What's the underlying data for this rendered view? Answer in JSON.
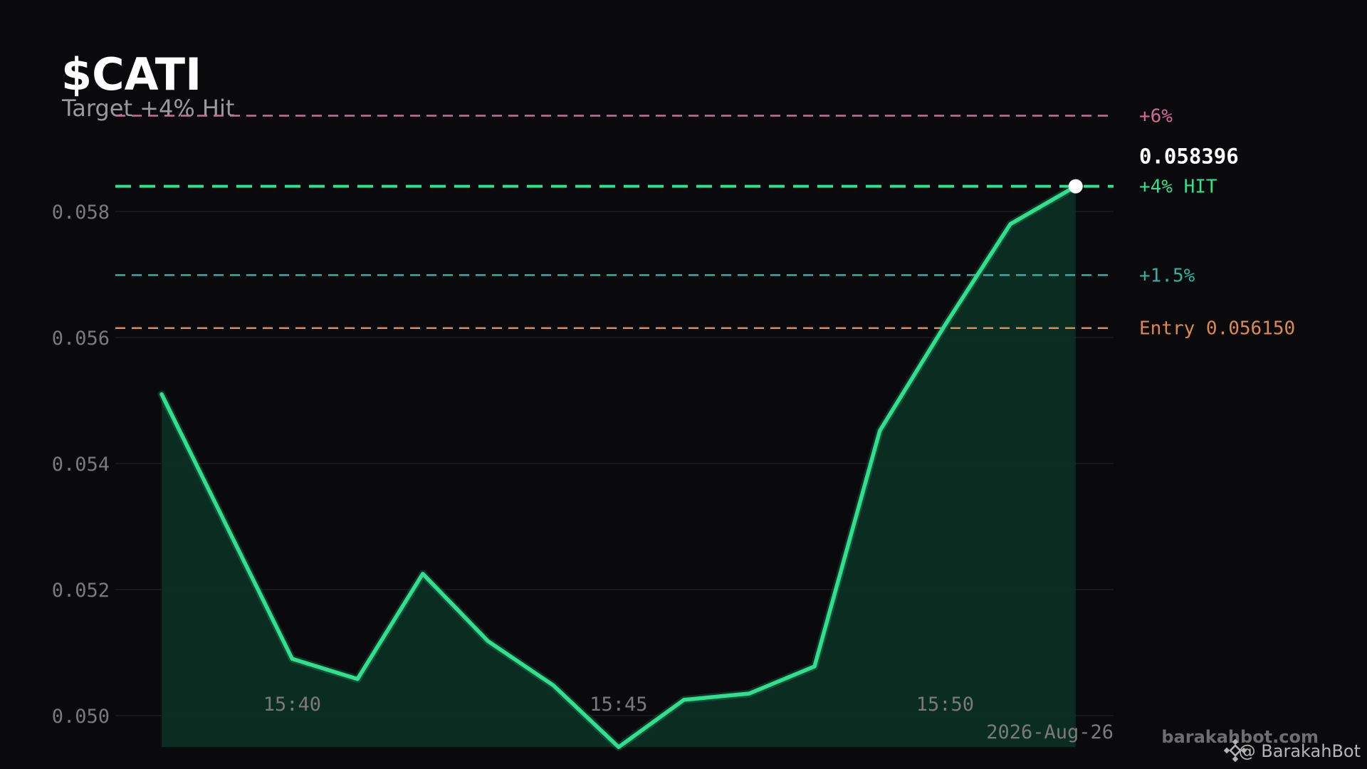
{
  "header": {
    "title": "$CATI",
    "subtitle": "Target +4% Hit"
  },
  "footer": {
    "date": "2026-Aug-26",
    "site": "barakahbot.com",
    "handle": "@ BarakahBot"
  },
  "colors": {
    "background": "#0a0a0c",
    "line": "#2ee08f",
    "area": "#0c2e22",
    "grid": "#1c1c1f",
    "level_plus6": "#d46a9a",
    "level_plus4": "#2ee08f",
    "level_plus1_5": "#2fb3a0",
    "level_entry": "#e08a4a"
  },
  "icons": {
    "brand": "binance-diamond-icon"
  },
  "chart_data": {
    "type": "line",
    "title": "$CATI",
    "subtitle": "Target +4% Hit",
    "x": [
      "15:38",
      "15:39",
      "15:40",
      "15:41",
      "15:42",
      "15:43",
      "15:44",
      "15:45",
      "15:46",
      "15:47",
      "15:48",
      "15:49",
      "15:50",
      "15:51",
      "15:52"
    ],
    "y": [
      0.0551,
      0.053,
      0.0509,
      0.05058,
      0.05225,
      0.05118,
      0.05048,
      0.0495,
      0.05025,
      0.05035,
      0.05078,
      0.05452,
      0.0562,
      0.0578,
      0.0584
    ],
    "x_ticks": [
      "15:40",
      "15:45",
      "15:50"
    ],
    "y_ticks": [
      "0.050",
      "0.052",
      "0.054",
      "0.056",
      "0.058"
    ],
    "ylim": [
      0.0487,
      0.06
    ],
    "grid": "horizontal",
    "last_price": "0.058396",
    "levels": [
      {
        "name": "plus6",
        "label": "+6%",
        "value": 0.05952,
        "color": "#d46a9a",
        "style": "dashed"
      },
      {
        "name": "plus4",
        "label": "+4%  HIT",
        "value": 0.0584,
        "color": "#2ee08f",
        "style": "dashed-bold"
      },
      {
        "name": "plus1_5",
        "label": "+1.5%",
        "value": 0.05699,
        "color": "#2fb3a0",
        "style": "dashed"
      },
      {
        "name": "entry",
        "label": "Entry 0.056150",
        "value": 0.05615,
        "color": "#e08a4a",
        "style": "dashed"
      }
    ]
  }
}
